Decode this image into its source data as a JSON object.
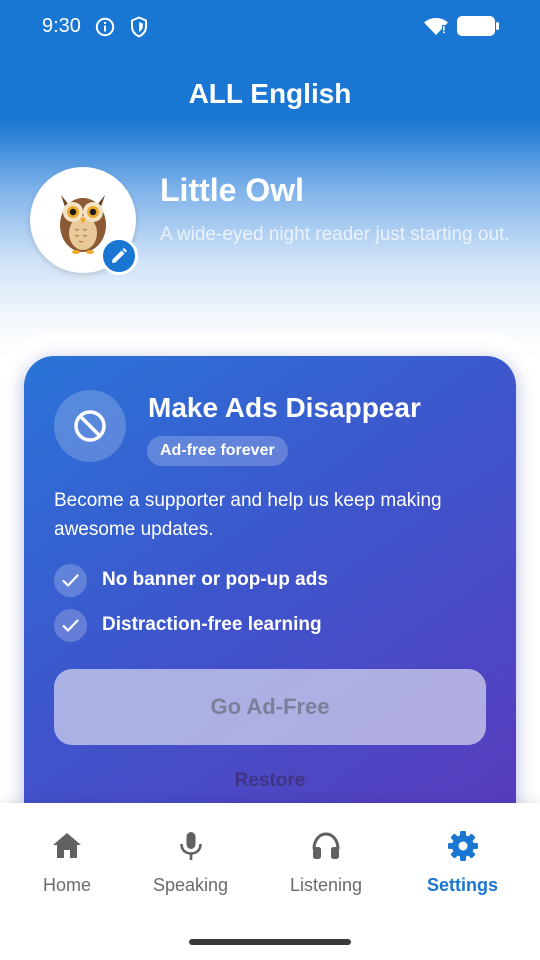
{
  "status_bar": {
    "time": "9:30"
  },
  "header": {
    "title": "ALL English"
  },
  "profile": {
    "name": "Little Owl",
    "description": "A wide-eyed night reader just starting out."
  },
  "promo": {
    "title": "Make Ads Disappear",
    "badge": "Ad-free forever",
    "description": "Become a supporter and help us keep making awesome updates.",
    "features": [
      "No banner or pop-up ads",
      "Distraction-free learning"
    ],
    "cta_label": "Go Ad-Free",
    "restore_label": "Restore"
  },
  "bottom_nav": {
    "items": [
      {
        "label": "Home",
        "icon": "home-icon",
        "active": false
      },
      {
        "label": "Speaking",
        "icon": "microphone-icon",
        "active": false
      },
      {
        "label": "Listening",
        "icon": "headphones-icon",
        "active": false
      },
      {
        "label": "Settings",
        "icon": "gear-icon",
        "active": true
      }
    ]
  },
  "colors": {
    "primary": "#1976d2",
    "card_gradient_start": "#2a74d8",
    "card_gradient_end": "#5a3bbd",
    "nav_inactive": "#6b6b6b"
  }
}
